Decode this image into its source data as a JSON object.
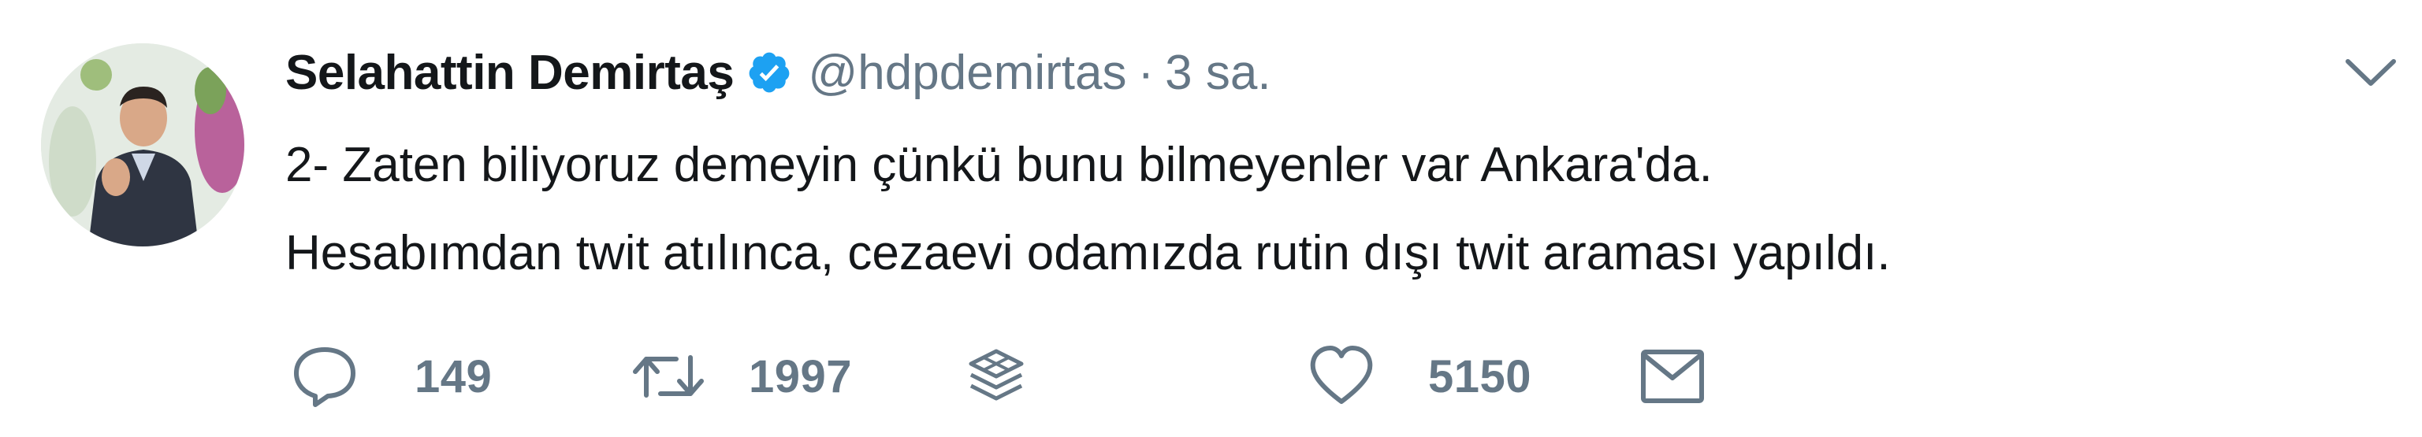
{
  "tweet": {
    "author_name": "Selahattin Demirtaş",
    "handle": "@hdpdemirtas",
    "separator": "·",
    "timestamp": "3 sa.",
    "text_lines": [
      "2- Zaten biliyoruz demeyin çünkü bunu bilmeyenler var Ankara'da.",
      "Hesabımdan twit atılınca, cezaevi odamızda rutin dışı twit araması yapıldı."
    ],
    "verified": true
  },
  "actions": {
    "reply_count": "149",
    "retweet_count": "1997",
    "like_count": "5150"
  },
  "colors": {
    "text": "#14171a",
    "secondary": "#657786",
    "verified_blue": "#1da1f2"
  },
  "icons": [
    "verified-badge-icon",
    "chevron-down-icon",
    "reply-icon",
    "retweet-icon",
    "stack-icon",
    "heart-icon",
    "mail-icon"
  ]
}
